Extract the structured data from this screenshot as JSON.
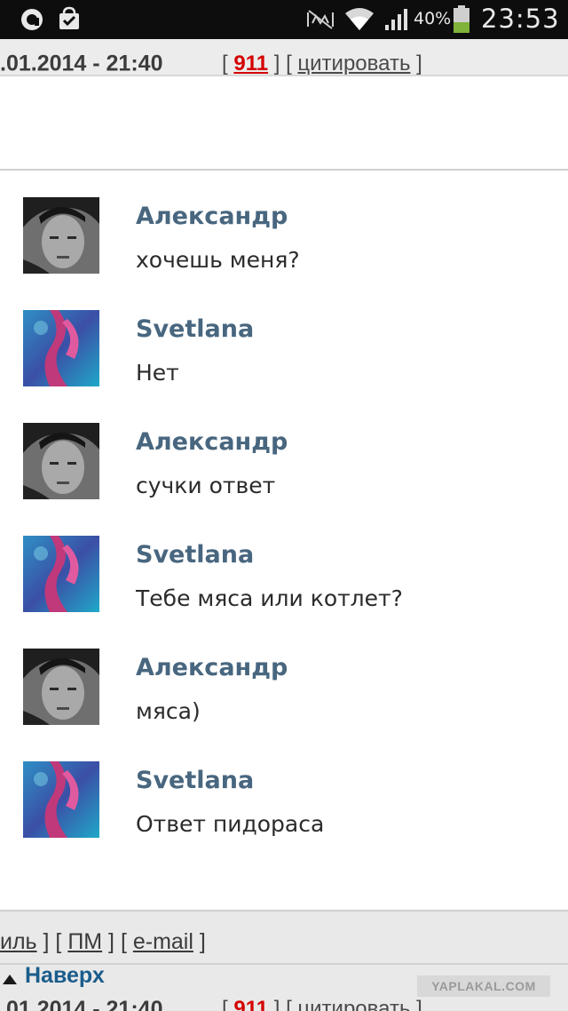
{
  "status_bar": {
    "battery_percent": "40%",
    "time": "23:53",
    "icons": [
      "opera-icon",
      "bag-check-icon",
      "mute-icon",
      "wifi-icon",
      "signal-icon",
      "battery-icon"
    ]
  },
  "prev_post": {
    "date": ".01.2014 - 21:40",
    "rating": "911",
    "quote_label": "цитировать"
  },
  "chat": {
    "messages": [
      {
        "author": "Александр",
        "text": "хочешь меня?",
        "avatar": "man-avatar"
      },
      {
        "author": "Svetlana",
        "text": "Нет",
        "avatar": "abstract-avatar"
      },
      {
        "author": "Александр",
        "text": "сучки ответ",
        "avatar": "man-avatar"
      },
      {
        "author": "Svetlana",
        "text": "Тебе мяса или котлет?",
        "avatar": "abstract-avatar"
      },
      {
        "author": "Александр",
        "text": "мяса)",
        "avatar": "man-avatar"
      },
      {
        "author": "Svetlana",
        "text": "Ответ пидораса",
        "avatar": "abstract-avatar"
      }
    ],
    "colors": {
      "author": "#48667f",
      "text": "#2b2b2b"
    }
  },
  "bottom": {
    "profile_link": "иль",
    "pm_link": "ПМ",
    "email_link": "e-mail",
    "up_label": "Наверх",
    "watermark": "YAPLAKAL.COM",
    "next_date": ".01.2014 - 21:40",
    "next_rating": "911",
    "next_quote_label": "цитировать"
  }
}
